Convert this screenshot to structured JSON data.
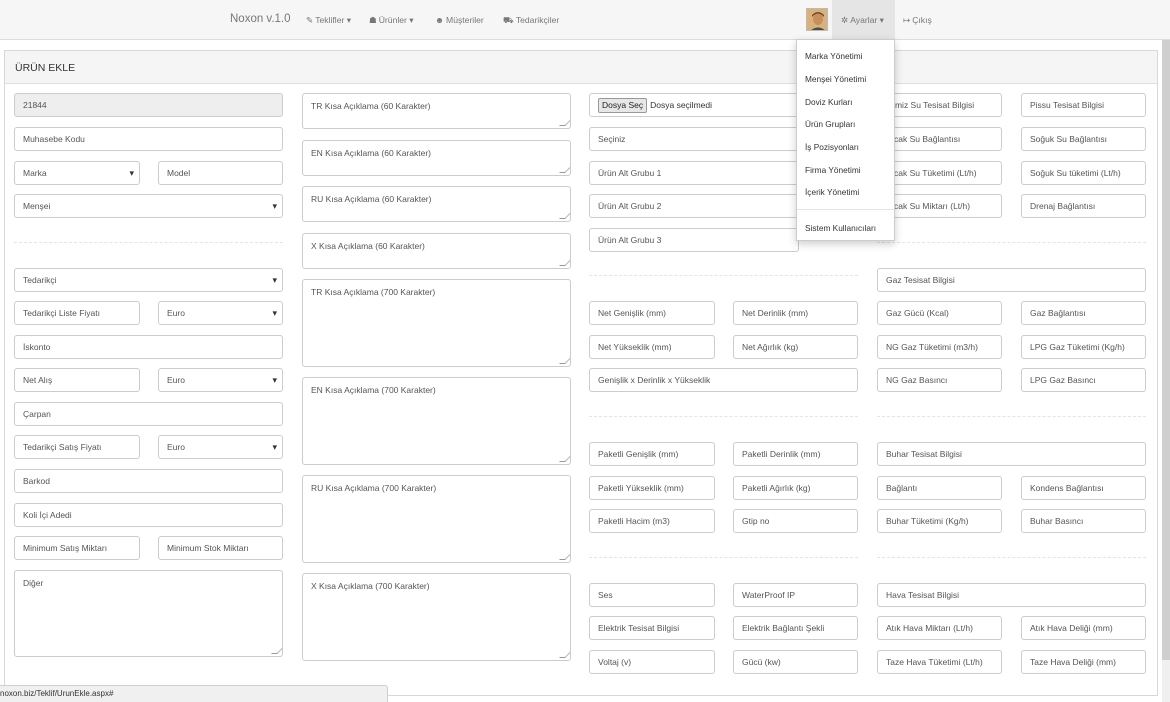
{
  "nav": {
    "brand": "Noxon v.1.0",
    "items": [
      {
        "label": "Teklifler",
        "icon": "pencil-icon",
        "dropdown": true
      },
      {
        "label": "Ürünler",
        "icon": "cubes-icon",
        "dropdown": true
      },
      {
        "label": "Müşteriler",
        "icon": "users-icon",
        "dropdown": false
      },
      {
        "label": "Tedarikçiler",
        "icon": "truck-icon",
        "dropdown": false
      }
    ],
    "settings": "Ayarlar",
    "logout": "Çıkış"
  },
  "settings_menu": [
    "Marka Yönetimi",
    "Menşei Yönetimi",
    "Doviz Kurları",
    "Ürün Grupları",
    "İş Pozisyonları",
    "Firma Yönetimi",
    "İçerik Yönetimi",
    "Sistem Kullanıcıları"
  ],
  "panel": {
    "title": "ÜRÜN EKLE"
  },
  "col1": {
    "code": "21844",
    "accounting_code": "Muhasebe Kodu",
    "brand_select": "Marka",
    "model": "Model",
    "origin_select": "Menşei",
    "supplier_select": "Tedarikçi",
    "supplier_list_price": "Tedarikçi Liste Fiyatı",
    "currency1": "Euro",
    "discount": "İskonto",
    "net_purchase": "Net Alış",
    "currency2": "Euro",
    "multiplier": "Çarpan",
    "supplier_sale_price": "Tedarikçi Satış Fiyatı",
    "currency3": "Euro",
    "barcode": "Barkod",
    "pack_qty": "Koli İçi Adedi",
    "min_sale_qty": "Minimum Satış Miktarı",
    "min_stock_qty": "Minimum Stok Miktarı",
    "other": "Diğer"
  },
  "col2": {
    "tr_short": "TR Kısa Açıklama (60 Karakter)",
    "en_short": "EN Kısa Açıklama (60 Karakter)",
    "ru_short": "RU Kısa Açıklama (60 Karakter)",
    "x_short": "X Kısa Açıklama (60 Karakter)",
    "tr_long": "TR Kısa Açıklama (700 Karakter)",
    "en_long": "EN Kısa Açıklama (700 Karakter)",
    "ru_long": "RU Kısa Açıklama (700 Karakter)",
    "x_long": "X Kısa Açıklama (700 Karakter)"
  },
  "col3": {
    "file_button": "Dosya Seç",
    "file_status": "Dosya seçilmedi",
    "group_select": "Seçiniz",
    "subgroup1": "Ürün Alt Grubu 1",
    "subgroup2": "Ürün Alt Grubu 2",
    "subgroup3": "Ürün Alt Grubu 3",
    "net_width": "Net Genişlik (mm)",
    "net_depth": "Net Derinlik (mm)",
    "net_height": "Net Yükseklik (mm)",
    "net_weight": "Net Ağırlık (kg)",
    "dimensions": "Genişlik x Derinlik x Yükseklik",
    "pkg_width": "Paketli Genişlik (mm)",
    "pkg_depth": "Paketli Derinlik (mm)",
    "pkg_height": "Paketli Yükseklik (mm)",
    "pkg_weight": "Paketli Ağırlık (kg)",
    "pkg_volume": "Paketli Hacim (m3)",
    "gtip": "Gtip no",
    "sound": "Ses",
    "waterproof": "WaterProof IP",
    "elec_install": "Elektrik Tesisat Bilgisi",
    "elec_conn": "Elektrik Bağlantı Şekli",
    "voltage": "Voltaj (v)",
    "power": "Gücü (kw)"
  },
  "col4": {
    "clean_water": "Temiz Su Tesisat Bilgisi",
    "dirty_water": "Pissu Tesisat Bilgisi",
    "hot_water_conn": "Sıcak Su Bağlantısı",
    "cold_water_conn": "Soğuk Su Bağlantısı",
    "hot_water_cons": "Sıcak Su Tüketimi (Lt/h)",
    "cold_water_cons": "Soğuk Su tüketimi (Lt/h)",
    "hot_water_amount": "Sıcak Su Miktarı (Lt/h)",
    "drain_conn": "Drenaj Bağlantısı",
    "gas_install": "Gaz Tesisat Bilgisi",
    "gas_power": "Gaz Gücü (Kcal)",
    "gas_conn": "Gaz Bağlantısı",
    "ng_cons": "NG Gaz Tüketimi (m3/h)",
    "lpg_cons": "LPG Gaz Tüketimi (Kg/h)",
    "ng_pressure": "NG Gaz Basıncı",
    "lpg_pressure": "LPG Gaz Basıncı",
    "steam_install": "Buhar Tesisat Bilgisi",
    "connection": "Bağlantı",
    "condense_conn": "Kondens Bağlantısı",
    "steam_cons": "Buhar Tüketimi (Kg/h)",
    "steam_pressure": "Buhar Basıncı",
    "air_install": "Hava Tesisat Bilgisi",
    "waste_air": "Atık Hava Miktarı (Lt/h)",
    "waste_air_hole": "Atık Hava Deliği (mm)",
    "fresh_air": "Taze Hava Tüketimi (Lt/h)",
    "fresh_air_hole": "Taze Hava Deliği (mm)"
  },
  "status_url": "noxon.biz/Teklif/UrunEkle.aspx#"
}
